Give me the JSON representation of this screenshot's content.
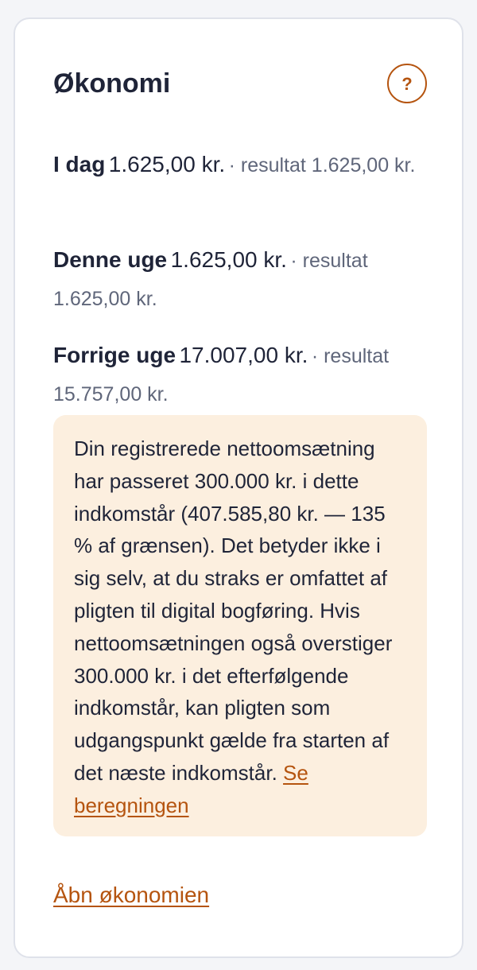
{
  "card": {
    "title": "Økonomi",
    "help_label": "?",
    "stats": {
      "today": {
        "label": "I dag",
        "amount": "1.625,00 kr.",
        "result": "· resultat 1.625,00 kr."
      },
      "this_week": {
        "label": "Denne uge",
        "amount": "1.625,00 kr.",
        "result": "· resultat 1.625,00 kr."
      },
      "last_week": {
        "label": "Forrige uge",
        "amount": "17.007,00 kr.",
        "result": "· resultat 15.757,00 kr."
      }
    },
    "notice": {
      "text": "Din registrerede nettoomsætning har passeret 300.000 kr. i dette indkomstår (407.585,80 kr. — 135 % af grænsen). Det betyder ikke i sig selv, at du straks er omfattet af pligten til digital bogføring. Hvis nettoomsætningen også overstiger 300.000 kr. i det efterfølgende indkomstår, kan pligten som udgangspunkt gælde fra starten af det næste indkomstår.",
      "link_label": "Se beregningen"
    },
    "footer_link": "Åbn økonomien"
  },
  "colors": {
    "accent": "#b5540f",
    "notice_background": "#fcefdf",
    "text": "#1f2438",
    "muted_text": "#5f667a",
    "card_border": "#dfe2ea"
  },
  "icons": {
    "help": "question-mark-icon"
  }
}
